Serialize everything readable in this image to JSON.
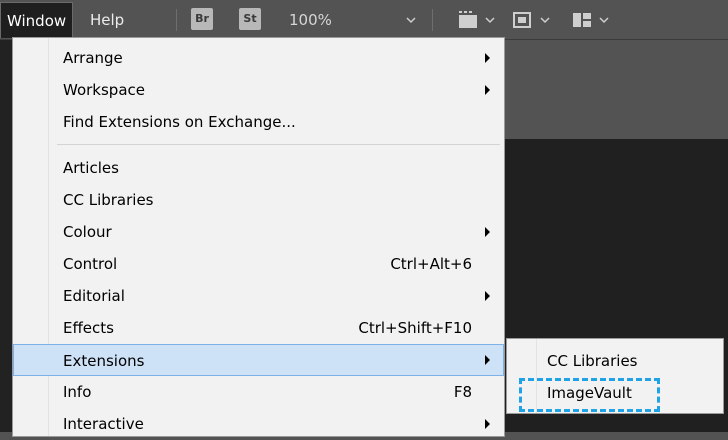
{
  "menubar": {
    "window_label": "Window",
    "help_label": "Help",
    "bridge_badge": "Br",
    "stock_badge": "St",
    "zoom": "100%"
  },
  "window_menu": {
    "items": [
      {
        "label": "Arrange",
        "shortcut": "",
        "submenu": true
      },
      {
        "label": "Workspace",
        "shortcut": "",
        "submenu": true
      },
      {
        "label": "Find Extensions on Exchange...",
        "shortcut": "",
        "submenu": false
      },
      {
        "label": "Articles",
        "shortcut": "",
        "submenu": false
      },
      {
        "label": "CC Libraries",
        "shortcut": "",
        "submenu": false
      },
      {
        "label": "Colour",
        "shortcut": "",
        "submenu": true
      },
      {
        "label": "Control",
        "shortcut": "Ctrl+Alt+6",
        "submenu": false
      },
      {
        "label": "Editorial",
        "shortcut": "",
        "submenu": true
      },
      {
        "label": "Effects",
        "shortcut": "Ctrl+Shift+F10",
        "submenu": false
      },
      {
        "label": "Extensions",
        "shortcut": "",
        "submenu": true
      },
      {
        "label": "Info",
        "shortcut": "F8",
        "submenu": false
      },
      {
        "label": "Interactive",
        "shortcut": "",
        "submenu": true
      }
    ]
  },
  "extensions_submenu": {
    "items": [
      {
        "label": "CC Libraries"
      },
      {
        "label": "ImageVault"
      }
    ]
  },
  "colors": {
    "menu_bg": "#f2f2f2",
    "highlight_bg": "#cde1f7",
    "callout_border": "#1fa2e6",
    "chrome_bg": "#535353"
  }
}
